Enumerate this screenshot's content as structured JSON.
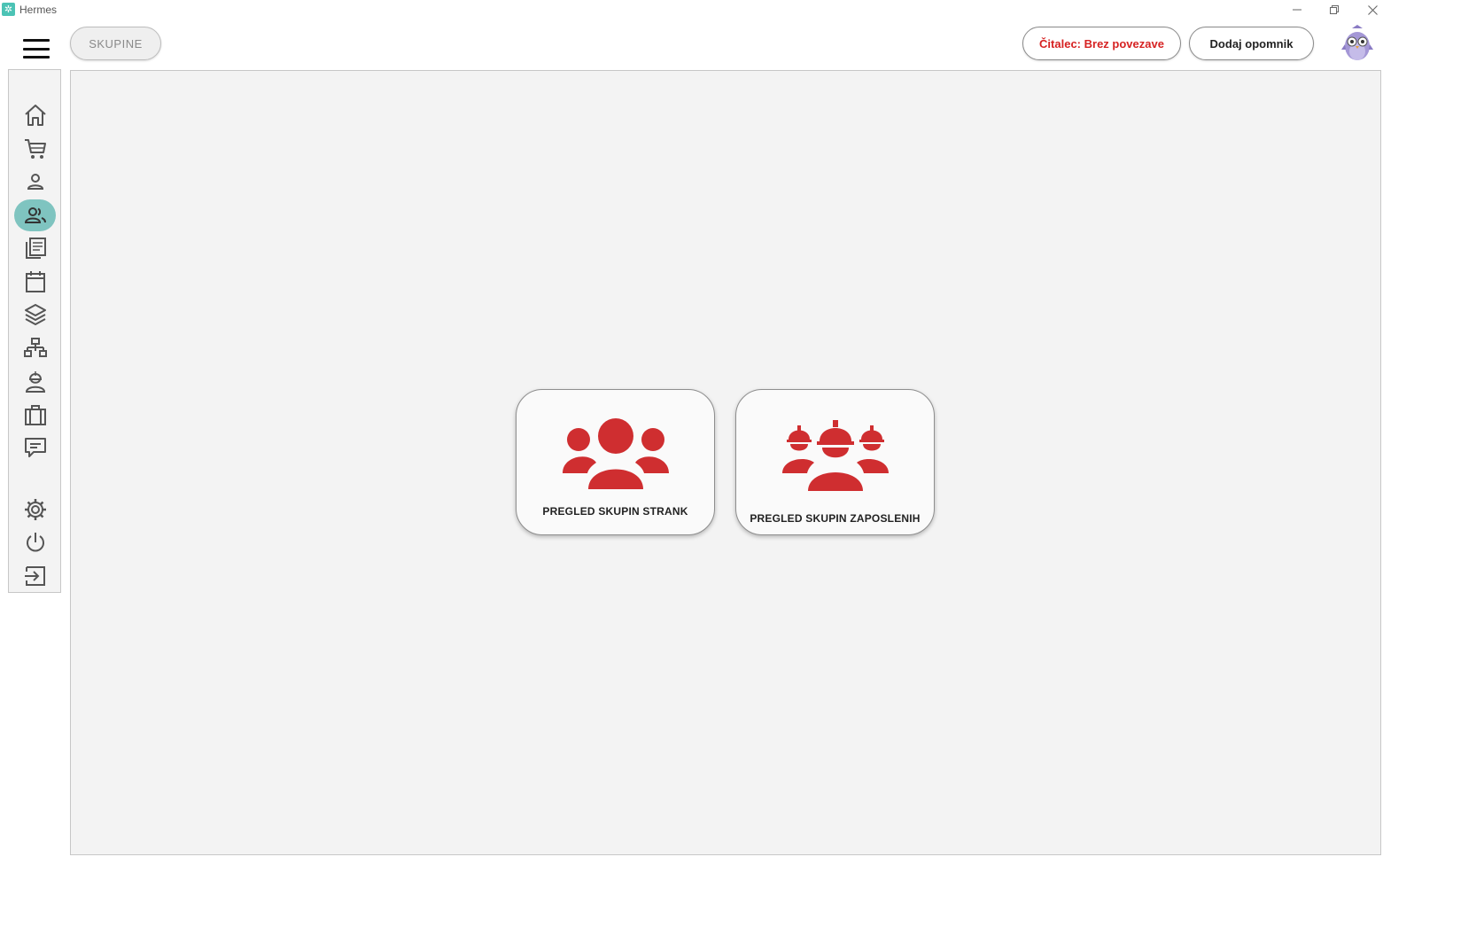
{
  "window": {
    "title": "Hermes",
    "controls": [
      "minimize-icon",
      "restore-icon",
      "close-icon"
    ]
  },
  "header": {
    "menu_icon": "hamburger-menu-icon",
    "section_label": "SKUPINE",
    "reader_status": "Čitalec: Brez povezave",
    "add_reminder": "Dodaj opomnik",
    "mascot": "owl-avatar-icon",
    "colors": {
      "reader_status": "#d62222",
      "active_nav": "#7fc4c0",
      "accent_red": "#cf2e30"
    }
  },
  "sidebar": {
    "items": [
      {
        "icon": "home-icon",
        "active": false
      },
      {
        "icon": "cart-icon",
        "active": false
      },
      {
        "icon": "person-icon",
        "active": false
      },
      {
        "icon": "group-icon",
        "active": true
      },
      {
        "icon": "documents-icon",
        "active": false
      },
      {
        "icon": "calendar-icon",
        "active": false
      },
      {
        "icon": "layers-icon",
        "active": false
      },
      {
        "icon": "network-icon",
        "active": false
      },
      {
        "icon": "worker-icon",
        "active": false
      },
      {
        "icon": "briefcase-icon",
        "active": false
      },
      {
        "icon": "chat-icon",
        "active": false
      },
      {
        "icon": "settings-icon",
        "active": false
      },
      {
        "icon": "power-icon",
        "active": false
      },
      {
        "icon": "logout-icon",
        "active": false
      }
    ]
  },
  "main": {
    "cards": [
      {
        "label": "PREGLED SKUPIN STRANK",
        "icon": "client-group-icon"
      },
      {
        "label": "PREGLED SKUPIN ZAPOSLENIH",
        "icon": "employee-group-hardhat-icon"
      }
    ]
  }
}
